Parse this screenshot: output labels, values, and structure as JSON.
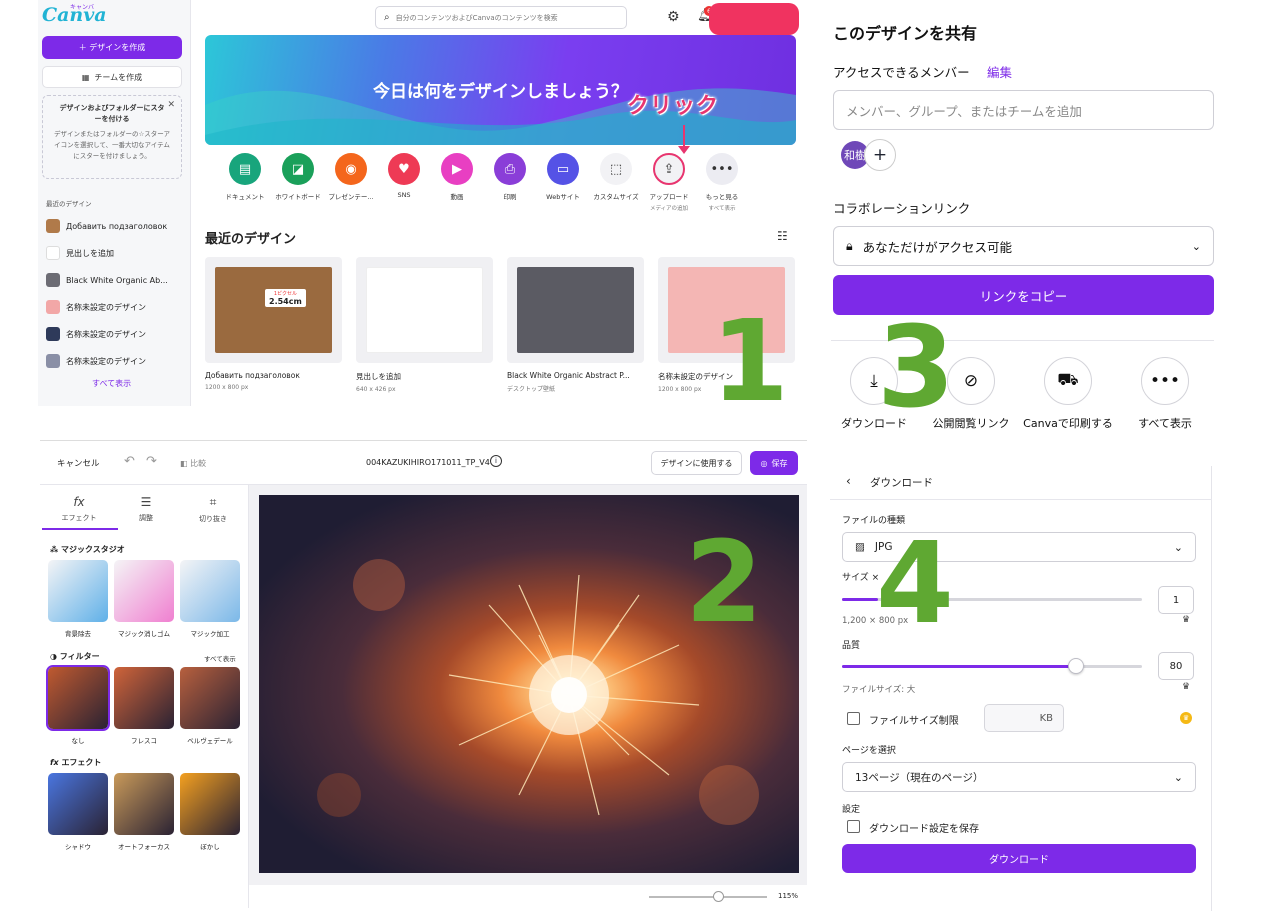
{
  "home": {
    "logo": "Canva",
    "logo_kana": "キャンバ",
    "create_button": "＋ デザインを作成",
    "team_button": "チームを作成",
    "promo_title": "デザインおよびフォルダーにスターを付ける",
    "promo_body": "デザインまたはフォルダーの☆スターアイコンを選択して、一番大切なアイテムにスターを付けましょう。",
    "recent_header": "最近のデザイン",
    "recent_items": [
      {
        "label": "Добавить подзаголовок",
        "color": "#b07a4a"
      },
      {
        "label": "見出しを追加",
        "color": "#ffffff"
      },
      {
        "label": "Black White Organic Ab...",
        "color": "#6c6c74"
      },
      {
        "label": "名称未設定のデザイン",
        "color": "#f2a7a7"
      },
      {
        "label": "名称未設定のデザイン",
        "color": "#2e3a5a"
      },
      {
        "label": "名称未設定のデザイン",
        "color": "#8a8fa6"
      }
    ],
    "see_all": "すべて表示",
    "search_placeholder": "自分のコンテンツおよびCanvaのコンテンツを検索",
    "notification_count": "6",
    "hero_title": "今日は何をデザインしましょう？",
    "click_label": "クリック",
    "categories": [
      {
        "label": "ドキュメント",
        "sub": "",
        "color": "#18a57c",
        "icon": "▤"
      },
      {
        "label": "ホワイトボード",
        "sub": "",
        "color": "#1aa05a",
        "icon": "◪"
      },
      {
        "label": "プレゼンテー...",
        "sub": "",
        "color": "#f4661c",
        "icon": "◉"
      },
      {
        "label": "SNS",
        "sub": "",
        "color": "#ee3a55",
        "icon": "♥"
      },
      {
        "label": "動画",
        "sub": "",
        "color": "#e83fc2",
        "icon": "▶"
      },
      {
        "label": "印刷",
        "sub": "",
        "color": "#8a3ed8",
        "icon": "⎙"
      },
      {
        "label": "Webサイト",
        "sub": "",
        "color": "#5552e6",
        "icon": "▭"
      },
      {
        "label": "カスタムサイズ",
        "sub": "",
        "color": "#f2f2f5",
        "icon": "⬚"
      },
      {
        "label": "アップロード",
        "sub": "メディアの追加",
        "color": "#f2f2f5",
        "icon": "⇪"
      },
      {
        "label": "もっと見る",
        "sub": "すべて表示",
        "color": "#ececf2",
        "icon": "•••"
      }
    ],
    "recent_title": "最近のデザイン",
    "cards": [
      {
        "title": "Добавить подзаголовок",
        "size": "1200 x 800 px",
        "color": "#9a6a3f",
        "overlay_top": "1ピクセル",
        "overlay_main": "2.54cm"
      },
      {
        "title": "見出しを追加",
        "size": "640 x 426 px",
        "color": "#ffffff",
        "overlay_top": "",
        "overlay_main": ""
      },
      {
        "title": "Black White Organic Abstract P...",
        "size": "デスクトップ壁紙",
        "color": "#5b5b63",
        "overlay_top": "",
        "overlay_main": ""
      },
      {
        "title": "名称未設定のデザイン",
        "size": "1200 x 800 px",
        "color": "#f4b6b4",
        "overlay_top": "",
        "overlay_main": ""
      }
    ],
    "step_number": "1"
  },
  "editor": {
    "cancel": "キャンセル",
    "compare": "比較",
    "filename": "004KAZUKIHIRO171011_TP_V4",
    "use_button": "デザインに使用する",
    "save_button": "保存",
    "tabs": [
      {
        "label": "エフェクト",
        "icon": "fx"
      },
      {
        "label": "調整",
        "icon": "☰"
      },
      {
        "label": "切り抜き",
        "icon": "⌗"
      }
    ],
    "magic_header": "マジックスタジオ",
    "magic_items": [
      {
        "label": "背景除去",
        "color": "#5fb0e8"
      },
      {
        "label": "マジック消しゴム",
        "color": "#f07fd0"
      },
      {
        "label": "マジック加工",
        "color": "#7bb8e8"
      }
    ],
    "filter_header": "フィルター",
    "filter_see_all": "すべて表示",
    "filter_items": [
      {
        "label": "なし",
        "color": "#c05a30"
      },
      {
        "label": "フレスコ",
        "color": "#d0643a"
      },
      {
        "label": "ベルヴェデール",
        "color": "#b8603e"
      }
    ],
    "effect_header": "エフェクト",
    "effect_items": [
      {
        "label": "シャドウ",
        "color": "#4a76e0"
      },
      {
        "label": "オートフォーカス",
        "color": "#c99a5a"
      },
      {
        "label": "ぼかし",
        "color": "#f4a020"
      }
    ],
    "zoom": "115%",
    "step_number": "2"
  },
  "share": {
    "title": "このデザインを共有",
    "access_label": "アクセスできるメンバー",
    "edit_link": "編集",
    "member_placeholder": "メンバー、グループ、またはチームを追加",
    "avatar": "和樹",
    "collab_label": "コラボレーションリンク",
    "access_value": "あなただけがアクセス可能",
    "copy_button": "リンクをコピー",
    "options": [
      {
        "label": "ダウンロード",
        "icon": "⤓"
      },
      {
        "label": "公開閲覧リンク",
        "icon": "⊘"
      },
      {
        "label": "Canvaで印刷する",
        "icon": "⛟"
      },
      {
        "label": "すべて表示",
        "icon": "•••"
      }
    ],
    "step_number": "3"
  },
  "download": {
    "title": "ダウンロード",
    "file_type_label": "ファイルの種類",
    "file_type": "JPG",
    "size_label": "サイズ ×",
    "size_value": "1",
    "size_level": 0.12,
    "dimensions": "1,200 × 800 px",
    "quality_label": "品質",
    "quality_value": "80",
    "quality_level": 0.78,
    "file_size": "ファイルサイズ: 大",
    "limit_label": "ファイルサイズ制限",
    "kb": "KB",
    "pages_label": "ページを選択",
    "pages_value": "13ページ（現在のページ）",
    "settings_label": "設定",
    "save_settings": "ダウンロード設定を保存",
    "download_button": "ダウンロード",
    "step_number": "4"
  }
}
